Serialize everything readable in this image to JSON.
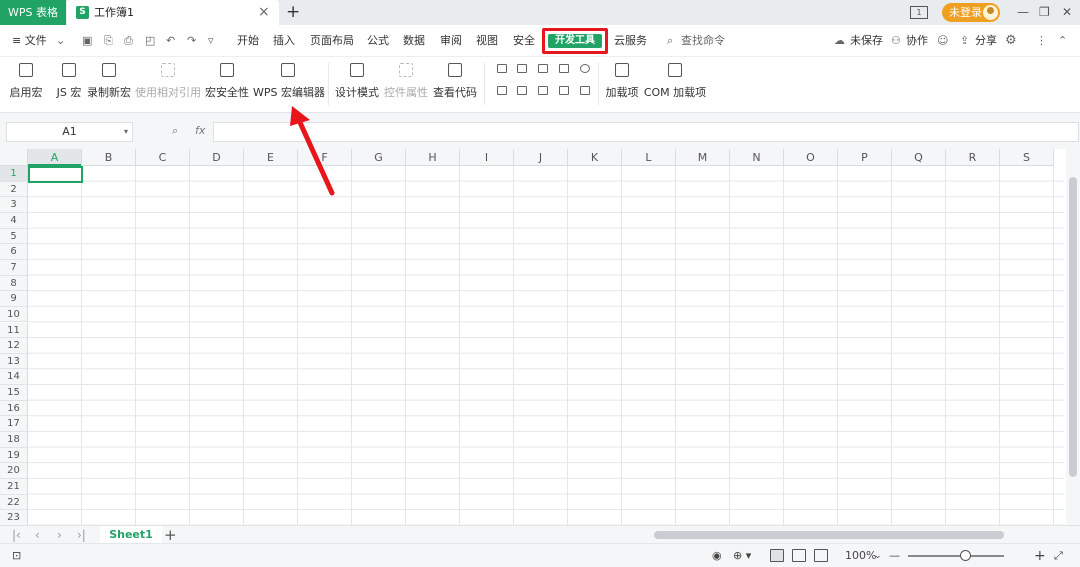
{
  "titlebar": {
    "app_name": "WPS 表格",
    "doc_tab": "工作簿1",
    "doc_icon": "S",
    "close": "×",
    "new_tab": "+",
    "page_indicator": "1",
    "login": "未登录",
    "minimize": "—",
    "restore": "❐",
    "close_window": "✕"
  },
  "menubar": {
    "file": "≡ 文件",
    "file_dd": "⌄",
    "tabs": [
      "开始",
      "插入",
      "页面布局",
      "公式",
      "数据",
      "审阅",
      "视图",
      "安全",
      "开发工具",
      "云服务"
    ],
    "active_tab": "开发工具",
    "search": "查找命令",
    "unsaved": "未保存",
    "collab": "协作",
    "share": "分享",
    "highlight_color": "#e8151b",
    "accent": "#21a366"
  },
  "ribbon": {
    "buttons": [
      {
        "label": "启用宏",
        "enabled": true
      },
      {
        "label": "JS 宏",
        "enabled": true
      },
      {
        "label": "录制新宏",
        "enabled": true
      },
      {
        "label": "使用相对引用",
        "enabled": false
      },
      {
        "label": "宏安全性",
        "enabled": true
      },
      {
        "label": "WPS 宏编辑器",
        "enabled": true
      },
      {
        "label": "设计模式",
        "enabled": true
      },
      {
        "label": "控件属性",
        "enabled": false
      },
      {
        "label": "查看代码",
        "enabled": true
      },
      {
        "label": "加载项",
        "enabled": true
      },
      {
        "label": "COM 加载项",
        "enabled": true
      }
    ]
  },
  "formula": {
    "cell_ref": "A1",
    "fx": "fx"
  },
  "grid": {
    "columns": [
      "A",
      "B",
      "C",
      "D",
      "E",
      "F",
      "G",
      "H",
      "I",
      "J",
      "K",
      "L",
      "M",
      "N",
      "O",
      "P",
      "Q",
      "R",
      "S"
    ],
    "rows": [
      "1",
      "2",
      "3",
      "4",
      "5",
      "6",
      "7",
      "8",
      "9",
      "10",
      "11",
      "12",
      "13",
      "14",
      "15",
      "16",
      "17",
      "18",
      "19",
      "20",
      "21",
      "22",
      "23"
    ],
    "selected": "A1"
  },
  "sheets": {
    "tabs": [
      "Sheet1"
    ],
    "add": "+"
  },
  "status": {
    "zoom": "100%",
    "zoom_dd": "⌄",
    "minus": "—",
    "plus": "+"
  }
}
